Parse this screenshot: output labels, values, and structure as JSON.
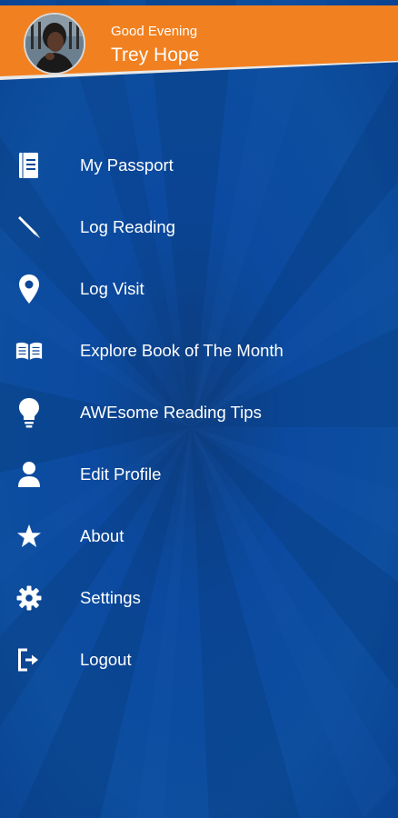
{
  "header": {
    "greeting": "Good Evening",
    "user_name": "Trey Hope",
    "accent_color": "#f18020"
  },
  "menu": {
    "items": [
      {
        "label": "My Passport",
        "icon": "passport-icon"
      },
      {
        "label": "Log Reading",
        "icon": "pencil-icon"
      },
      {
        "label": "Log Visit",
        "icon": "map-pin-icon"
      },
      {
        "label": "Explore Book of The Month",
        "icon": "open-book-icon"
      },
      {
        "label": "AWEsome Reading Tips",
        "icon": "lightbulb-icon"
      },
      {
        "label": "Edit Profile",
        "icon": "person-icon"
      },
      {
        "label": "About",
        "icon": "star-icon"
      },
      {
        "label": "Settings",
        "icon": "gear-icon"
      },
      {
        "label": "Logout",
        "icon": "logout-icon"
      }
    ]
  },
  "theme": {
    "background": "#0d4796",
    "text": "#ffffff"
  }
}
